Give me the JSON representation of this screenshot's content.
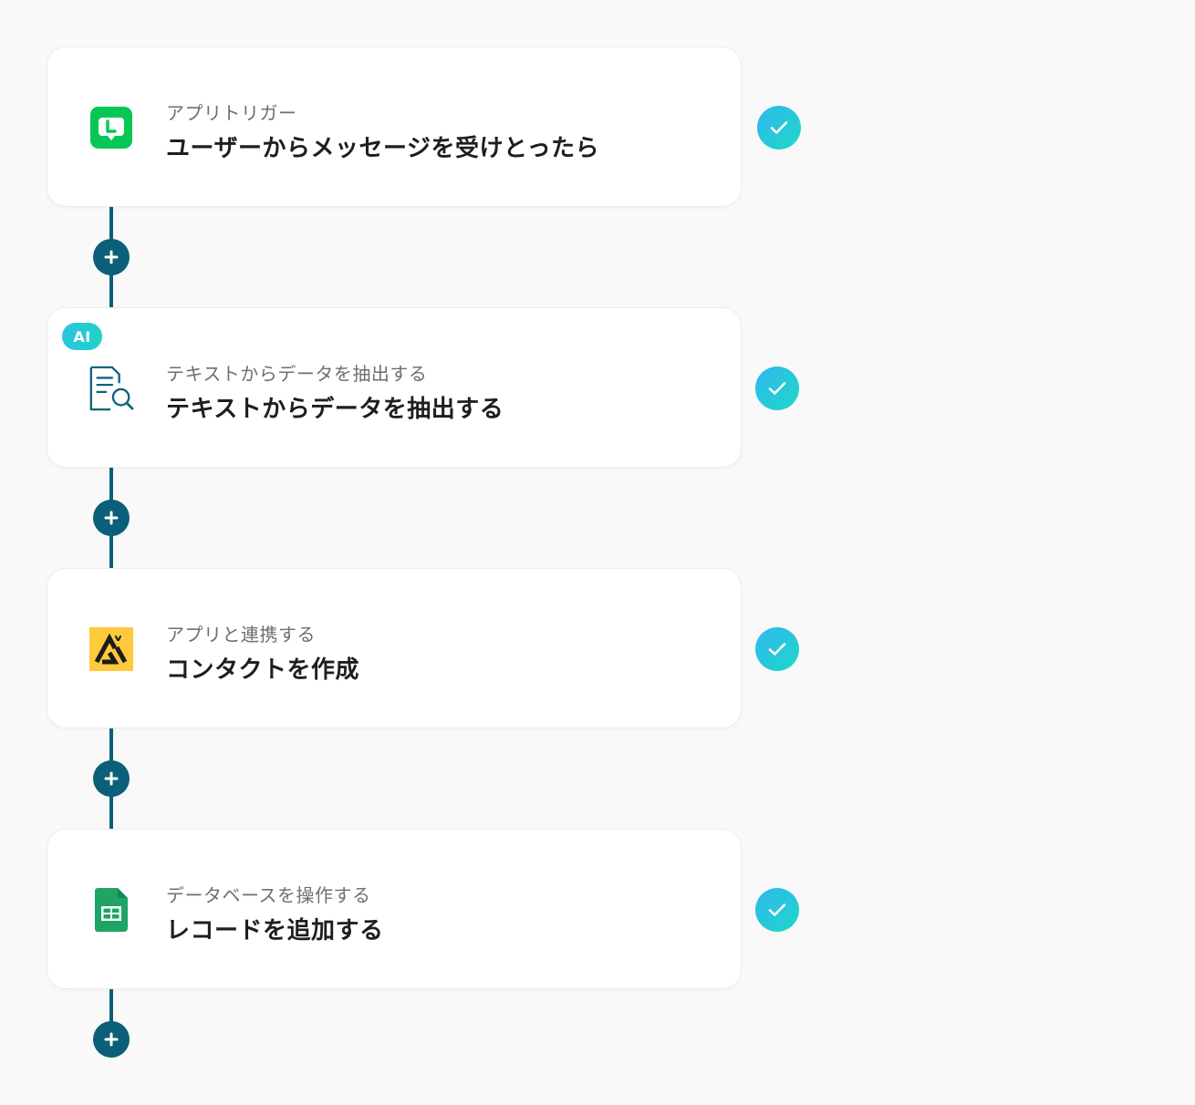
{
  "steps": [
    {
      "subtitle": "アプリトリガー",
      "title": "ユーザーからメッセージを受けとったら",
      "icon": "line-app-icon",
      "status": "check-icon"
    },
    {
      "badge": "AI",
      "subtitle": "テキストからデータを抽出する",
      "title": "テキストからデータを抽出する",
      "icon": "document-search-icon",
      "status": "check-icon"
    },
    {
      "subtitle": "アプリと連携する",
      "title": "コンタクトを作成",
      "icon": "attio-app-icon",
      "status": "check-icon"
    },
    {
      "subtitle": "データベースを操作する",
      "title": "レコードを追加する",
      "icon": "google-sheets-icon",
      "status": "check-icon"
    }
  ],
  "add_button_icon": "plus-icon",
  "colors": {
    "background": "#f9f9f9",
    "connector": "#0c5f79",
    "check_gradient_start": "#2fb7f0",
    "check_gradient_end": "#1fd8c6",
    "line_green": "#06c755",
    "attio_yellow": "#ffc93c",
    "sheets_green": "#1fa463"
  }
}
